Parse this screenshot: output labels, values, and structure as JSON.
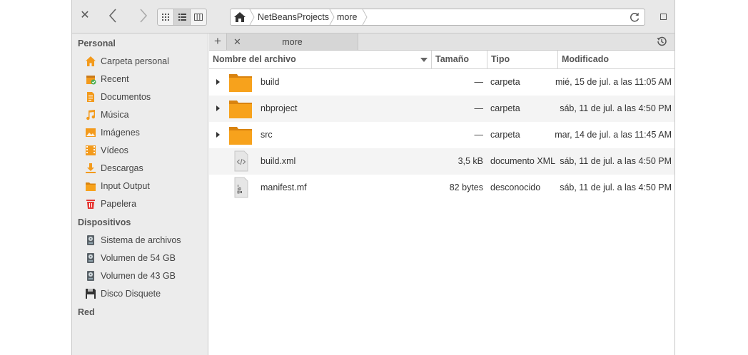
{
  "sidebar": {
    "sections": [
      {
        "heading": "Personal"
      },
      {
        "heading": "Dispositivos"
      },
      {
        "heading": "Red"
      }
    ],
    "personal": [
      {
        "label": "Carpeta personal",
        "icon": "home-icon"
      },
      {
        "label": "Recent",
        "icon": "recent-icon"
      },
      {
        "label": "Documentos",
        "icon": "documents-icon"
      },
      {
        "label": "Música",
        "icon": "music-icon"
      },
      {
        "label": "Imágenes",
        "icon": "pictures-icon"
      },
      {
        "label": "Vídeos",
        "icon": "videos-icon"
      },
      {
        "label": "Descargas",
        "icon": "downloads-icon"
      },
      {
        "label": "Input Output",
        "icon": "folder-icon"
      },
      {
        "label": "Papelera",
        "icon": "trash-icon"
      }
    ],
    "devices": [
      {
        "label": "Sistema de archivos",
        "icon": "drive-icon"
      },
      {
        "label": "Volumen de 54 GB",
        "icon": "drive-icon"
      },
      {
        "label": "Volumen de 43 GB",
        "icon": "drive-icon"
      },
      {
        "label": "Disco Disquete",
        "icon": "floppy-icon"
      }
    ]
  },
  "pathbar": {
    "crumbs": [
      "NetBeansProjects",
      "more"
    ]
  },
  "tabs": [
    {
      "label": "more"
    }
  ],
  "columns": {
    "name": "Nombre del archivo",
    "size": "Tamaño",
    "type": "Tipo",
    "modified": "Modificado"
  },
  "files": [
    {
      "name": "build",
      "size": "—",
      "type": "carpeta",
      "modified": "mié, 15 de jul. a las 11:05 AM",
      "kind": "folder"
    },
    {
      "name": "nbproject",
      "size": "—",
      "type": "carpeta",
      "modified": "sáb, 11 de jul. a las 4:50 PM",
      "kind": "folder"
    },
    {
      "name": "src",
      "size": "—",
      "type": "carpeta",
      "modified": "mar, 14 de jul. a las 11:45 AM",
      "kind": "folder"
    },
    {
      "name": "build.xml",
      "size": "3,5 kB",
      "type": "documento XML",
      "modified": "sáb, 11 de jul. a las 4:50 PM",
      "kind": "xml"
    },
    {
      "name": "manifest.mf",
      "size": "82 bytes",
      "type": "desconocido",
      "modified": "sáb, 11 de jul. a las 4:50 PM",
      "kind": "binary"
    }
  ],
  "colors": {
    "folder": "#f7a21c",
    "accent": "#f39a1b"
  }
}
